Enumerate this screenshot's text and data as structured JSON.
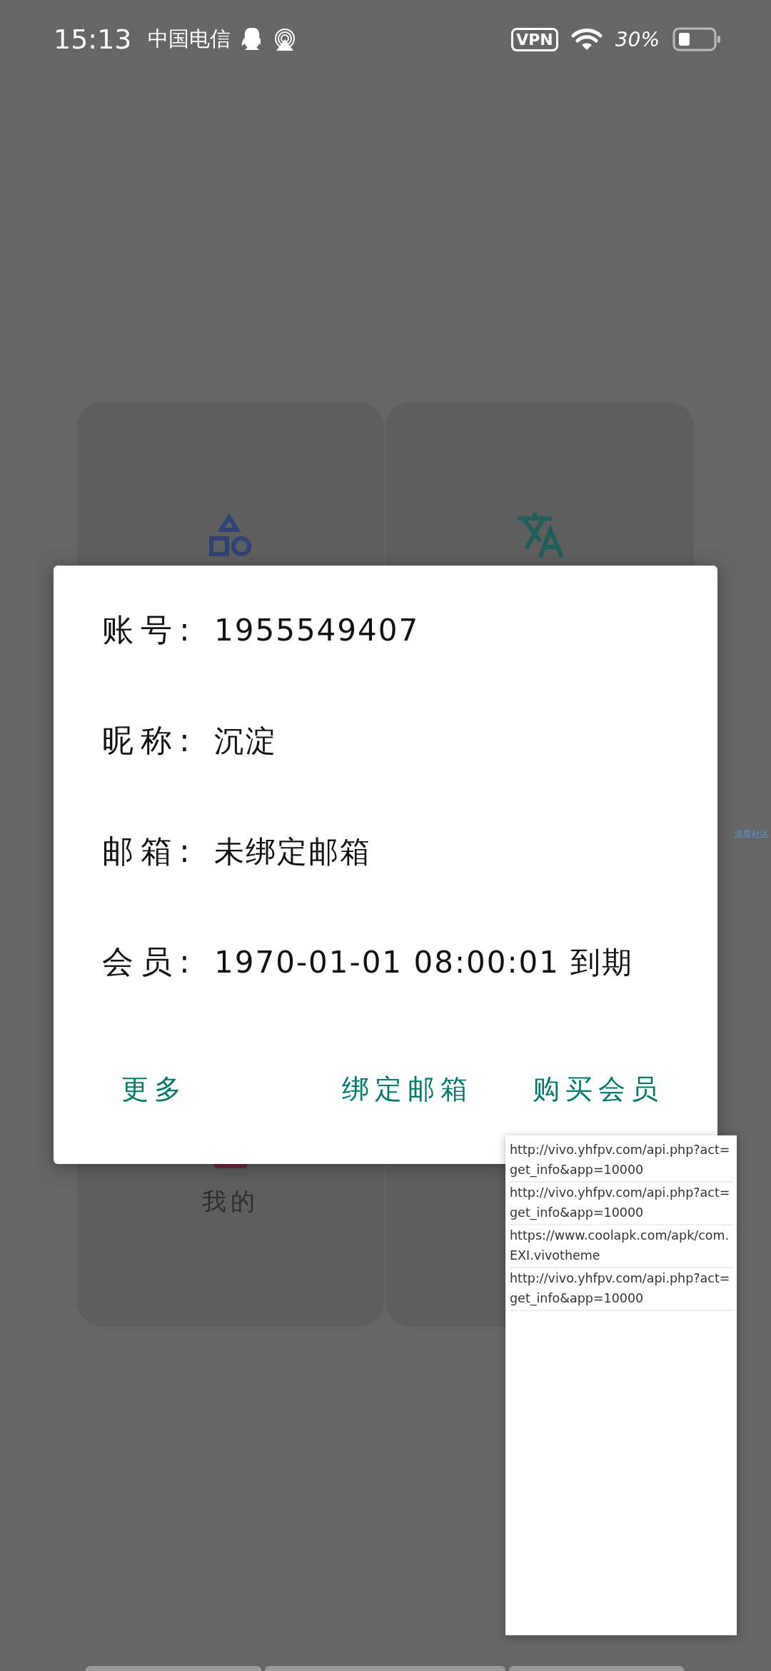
{
  "status_bar": {
    "time": "15:13",
    "carrier": "中国电信",
    "vpn": "VPN",
    "battery": "30%"
  },
  "cards": [
    {
      "kind": "shapes"
    },
    {
      "kind": "translate"
    },
    {
      "kind": "profile",
      "label": "我的"
    },
    {
      "kind": "blank"
    }
  ],
  "dialog": {
    "rows": [
      {
        "label": "账号:",
        "value": "1955549407"
      },
      {
        "label": "昵称:",
        "value": "沉淀"
      },
      {
        "label": "邮箱:",
        "value": "未绑定邮箱"
      },
      {
        "label": "会员:",
        "value": "1970-01-01 08:00:01 到期"
      }
    ],
    "buttons": [
      "更多",
      "绑定邮箱",
      "购买会员"
    ]
  },
  "side_text": "流星社区",
  "log_panel": {
    "entries": [
      "http://vivo.yhfpv.com/api.php?act=get_info&app=10000",
      "http://vivo.yhfpv.com/api.php?act=get_info&app=10000",
      "https://www.coolapk.com/apk/com.EXI.vivotheme",
      "http://vivo.yhfpv.com/api.php?act=get_info&app=10000"
    ]
  }
}
